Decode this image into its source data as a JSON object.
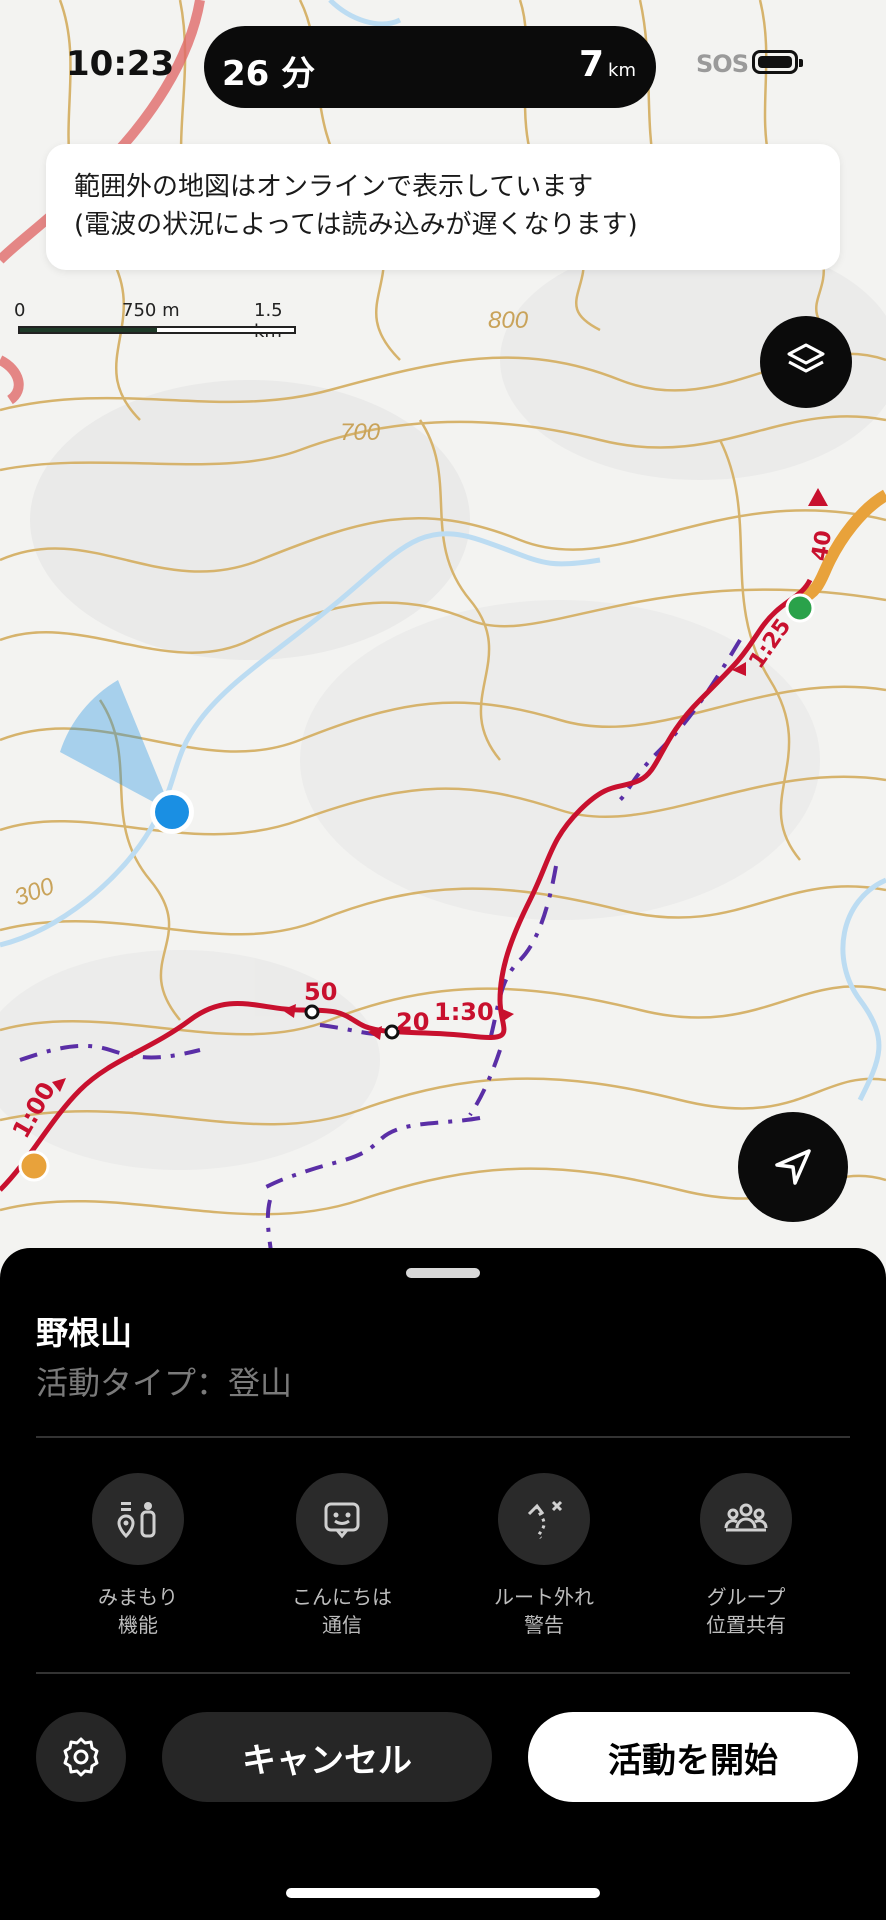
{
  "status_bar": {
    "time": "10:23",
    "sos": "SOS"
  },
  "island": {
    "duration": "26 分",
    "distance_value": "7",
    "distance_unit": "km"
  },
  "notice": {
    "line1": "範囲外の地図はオンラインで表示しています",
    "line2": "(電波の状況によっては読み込みが遅くなります)"
  },
  "scale": {
    "zero": "0",
    "mid": "750 m",
    "max": "1.5 km"
  },
  "map": {
    "contour_labels": [
      "800",
      "700",
      "300"
    ],
    "route_labels": [
      "40",
      "1:25",
      "1:30",
      "50",
      "20",
      "1:00"
    ],
    "colors": {
      "route": "#c8102e",
      "alt_trail": "#5a2ea6",
      "road": "#e8a23b",
      "location": "#1a8fe3",
      "contour": "#d6b36c",
      "river": "#b9d9f0"
    }
  },
  "sheet": {
    "title": "野根山",
    "subtitle": "活動タイプ：登山",
    "features": [
      {
        "line1": "みまもり",
        "line2": "機能",
        "icon": "watch-over-icon"
      },
      {
        "line1": "こんにちは",
        "line2": "通信",
        "icon": "hello-comm-icon"
      },
      {
        "line1": "ルート外れ",
        "line2": "警告",
        "icon": "off-route-icon"
      },
      {
        "line1": "グループ",
        "line2": "位置共有",
        "icon": "group-share-icon"
      }
    ],
    "cancel_label": "キャンセル",
    "start_label": "活動を開始"
  }
}
